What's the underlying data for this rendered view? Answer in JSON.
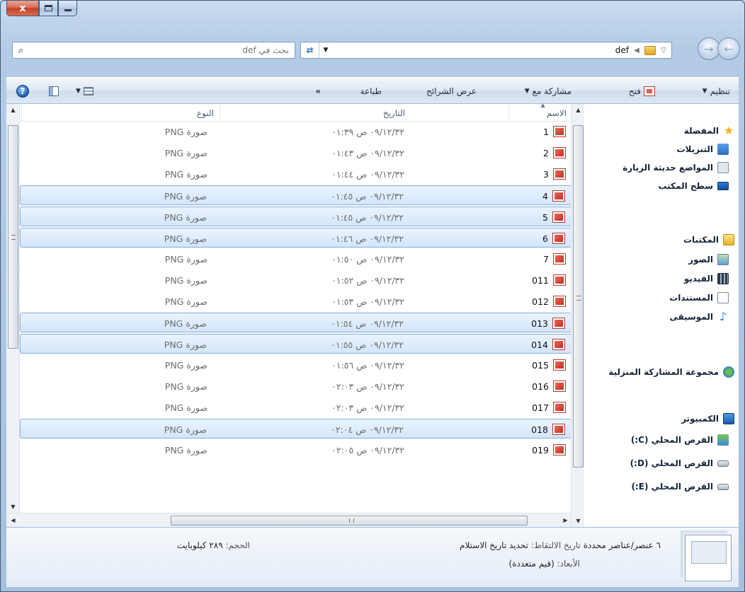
{
  "window": {
    "caption": {
      "close": "x"
    }
  },
  "address": {
    "search_placeholder": "بحث في def",
    "path": "def"
  },
  "toolbar": {
    "organize": "تنظيم",
    "open": "فتح",
    "share_with": "مشاركة مع",
    "slideshow": "عرض الشرائح",
    "print": "طباعة",
    "more": "»"
  },
  "nav_pane": {
    "favorites": "المفضلة",
    "downloads": "التنزيلات",
    "recent_places": "المواضع حديثة الزيارة",
    "desktop": "سطح المكتب",
    "libraries": "المكتبات",
    "pictures": "الصور",
    "videos": "الفيديو",
    "documents": "المستندات",
    "music": "الموسيقى",
    "homegroup": "مجموعة المشاركة المنزلية",
    "computer": "الكمبيوتر",
    "drive_c": "القرص المحلي (C:)",
    "drive_d": "القرص المحلي (D:)",
    "drive_e": "القرص المحلي (E:)"
  },
  "file_list": {
    "columns": {
      "name": "الاسم",
      "date": "التاريخ",
      "type": "النوع"
    },
    "rows": [
      {
        "name": "1",
        "date": "٠٩/١٢/٣٢ ص ٠١:٣٩",
        "type": "صورة PNG",
        "selected": false
      },
      {
        "name": "2",
        "date": "٠٩/١٢/٣٢ ص ٠١:٤٣",
        "type": "صورة PNG",
        "selected": false
      },
      {
        "name": "3",
        "date": "٠٩/١٢/٣٢ ص ٠١:٤٤",
        "type": "صورة PNG",
        "selected": false
      },
      {
        "name": "4",
        "date": "٠٩/١٢/٣٢ ص ٠١:٤٥",
        "type": "صورة PNG",
        "selected": true
      },
      {
        "name": "5",
        "date": "٠٩/١٢/٣٢ ص ٠١:٤٥",
        "type": "صورة PNG",
        "selected": true
      },
      {
        "name": "6",
        "date": "٠٩/١٢/٣٢ ص ٠١:٤٦",
        "type": "صورة PNG",
        "selected": true
      },
      {
        "name": "7",
        "date": "٠٩/١٢/٣٢ ص ٠١:٥٠",
        "type": "صورة PNG",
        "selected": false
      },
      {
        "name": "011",
        "date": "٠٩/١٢/٣٢ ص ٠١:٥٢",
        "type": "صورة PNG",
        "selected": false
      },
      {
        "name": "012",
        "date": "٠٩/١٢/٣٢ ص ٠١:٥٣",
        "type": "صورة PNG",
        "selected": false
      },
      {
        "name": "013",
        "date": "٠٩/١٢/٣٢ ص ٠١:٥٤",
        "type": "صورة PNG",
        "selected": true
      },
      {
        "name": "014",
        "date": "٠٩/١٢/٣٢ ص ٠١:٥٥",
        "type": "صورة PNG",
        "selected": true
      },
      {
        "name": "015",
        "date": "٠٩/١٢/٣٢ ص ٠١:٥٦",
        "type": "صورة PNG",
        "selected": false
      },
      {
        "name": "016",
        "date": "٠٩/١٢/٣٢ ص ٠٢:٠٣",
        "type": "صورة PNG",
        "selected": false
      },
      {
        "name": "017",
        "date": "٠٩/١٢/٣٢ ص ٠٢:٠٣",
        "type": "صورة PNG",
        "selected": false
      },
      {
        "name": "018",
        "date": "٠٩/١٢/٣٢ ص ٠٢:٠٤",
        "type": "صورة PNG",
        "selected": true
      },
      {
        "name": "019",
        "date": "٠٩/١٢/٣٢ ص ٠٢:٠٥",
        "type": "صورة PNG",
        "selected": false
      }
    ]
  },
  "details": {
    "selection_count": "٦ عنصر/عناصر محددة",
    "date_taken_label": "تاريخ الالتقاط:",
    "date_taken_value": "تحديد تاريخ الاستلام",
    "dimensions_label": "الأبعاد:",
    "dimensions_value": "(قيم متعددة)",
    "size_label": "الحجم:",
    "size_value": "٢٨٩ كيلوبايت"
  }
}
